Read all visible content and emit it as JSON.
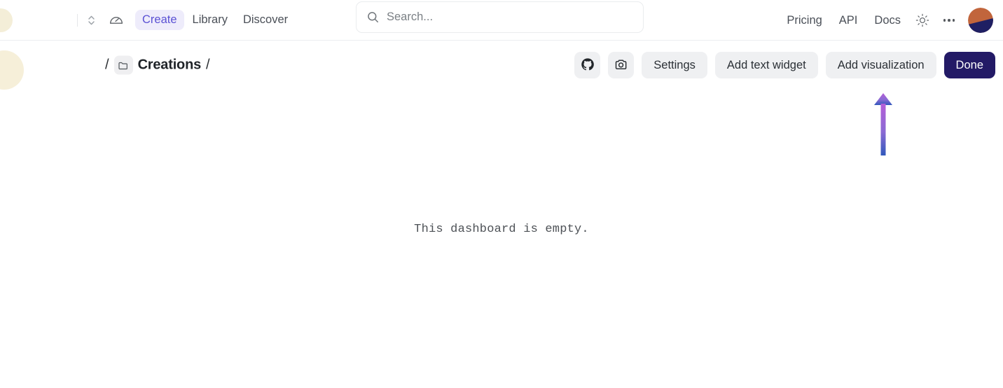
{
  "topnav": {
    "brand_avatar": "brand-avatar",
    "workspace_switcher_icon": "chevron-up-down-icon",
    "gauge_icon": "gauge-icon",
    "links": [
      {
        "label": "Create",
        "active": true
      },
      {
        "label": "Library",
        "active": false
      },
      {
        "label": "Discover",
        "active": false
      }
    ],
    "search": {
      "placeholder": "Search...",
      "value": "",
      "icon": "search-icon"
    },
    "right_links": [
      {
        "label": "Pricing"
      },
      {
        "label": "API"
      },
      {
        "label": "Docs"
      }
    ],
    "theme_toggle_icon": "sun-icon",
    "overflow_icon": "ellipsis-icon",
    "user_avatar": {
      "name": "user-avatar",
      "top_color": "#c1653c",
      "bottom_color": "#1f1f63"
    }
  },
  "toolbar": {
    "page_avatar": "page-avatar",
    "breadcrumb": {
      "leading_slash": "/",
      "folder_icon": "folder-icon",
      "name": "Creations",
      "trailing_slash": "/"
    },
    "github_icon": "github-icon",
    "camera_icon": "camera-icon",
    "settings_label": "Settings",
    "add_text_widget_label": "Add text widget",
    "add_visualization_label": "Add visualization",
    "done_label": "Done"
  },
  "canvas": {
    "empty_message": "This dashboard is empty."
  },
  "annotation": {
    "arrow": {
      "name": "up-arrow-annotation",
      "top_color": "#b55fd8",
      "bottom_color": "#3159bc"
    }
  },
  "colors": {
    "accent": "#5b52d4",
    "accent_pill_bg": "#eeecfb",
    "primary_button": "#231a66",
    "neutral_button": "#eff0f2",
    "page_bg": "#ffffff",
    "border": "#eceef0"
  }
}
